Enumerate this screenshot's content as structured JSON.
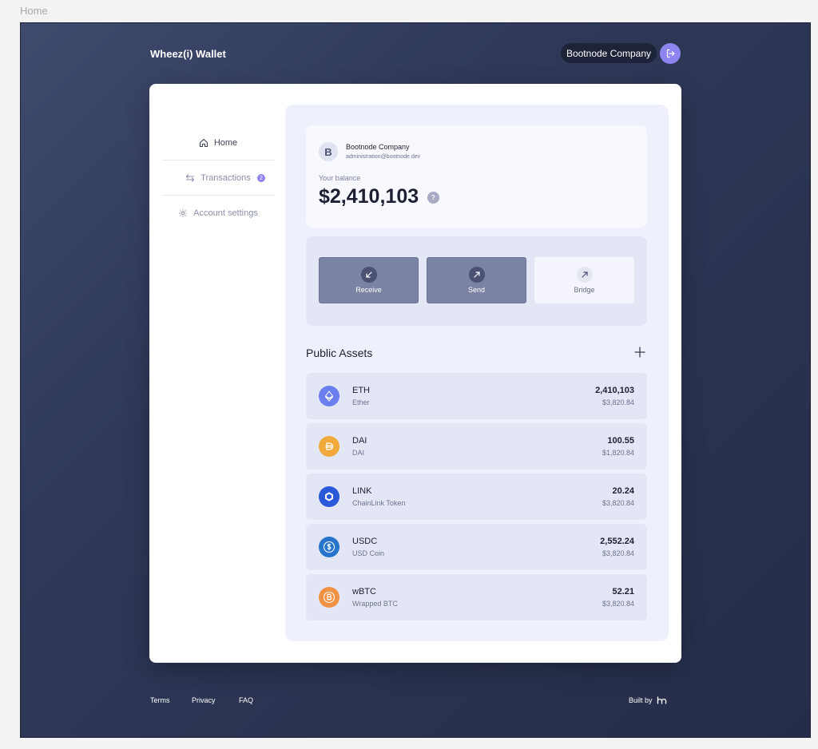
{
  "page": {
    "label": "Home"
  },
  "header": {
    "brand": "Wheez(i) Wallet",
    "company": "Bootnode Company"
  },
  "sidebar": {
    "items": [
      {
        "label": "Home",
        "icon": "home-icon"
      },
      {
        "label": "Transactions",
        "icon": "swap-icon",
        "badge": "2"
      },
      {
        "label": "Account settings",
        "icon": "gear-icon"
      }
    ]
  },
  "account": {
    "initial": "B",
    "name": "Bootnode Company",
    "email": "administration@bootnode.dev",
    "balance_label": "Your balance",
    "balance": "$2,410,103",
    "help": "?"
  },
  "actions": [
    {
      "label": "Receive",
      "icon": "arrow-down-left-icon"
    },
    {
      "label": "Send",
      "icon": "arrow-up-right-icon"
    },
    {
      "label": "Bridge",
      "icon": "arrow-up-right-icon"
    }
  ],
  "assets": {
    "title": "Public Assets",
    "items": [
      {
        "symbol": "ETH",
        "name": "Ether",
        "amount": "2,410,103",
        "usd": "$3,820.84",
        "icon": "eth-icon",
        "color": "#6b7ff0"
      },
      {
        "symbol": "DAI",
        "name": "DAI",
        "amount": "100.55",
        "usd": "$1,820.84",
        "icon": "dai-icon",
        "color": "#f2a93b"
      },
      {
        "symbol": "LINK",
        "name": "ChainLink Token",
        "amount": "20.24",
        "usd": "$3,820.84",
        "icon": "link-icon",
        "color": "#2a5ada"
      },
      {
        "symbol": "USDC",
        "name": "USD Coin",
        "amount": "2,552.24",
        "usd": "$3,820.84",
        "icon": "usdc-icon",
        "color": "#2775ca"
      },
      {
        "symbol": "wBTC",
        "name": "Wrapped BTC",
        "amount": "52.21",
        "usd": "$3,820.84",
        "icon": "btc-icon",
        "color": "#f09242"
      }
    ]
  },
  "footer": {
    "links": [
      "Terms",
      "Privacy",
      "FAQ"
    ],
    "built_by": "Built by"
  },
  "colors": {
    "accent": "#8d84f0",
    "background": "#2f3858"
  }
}
